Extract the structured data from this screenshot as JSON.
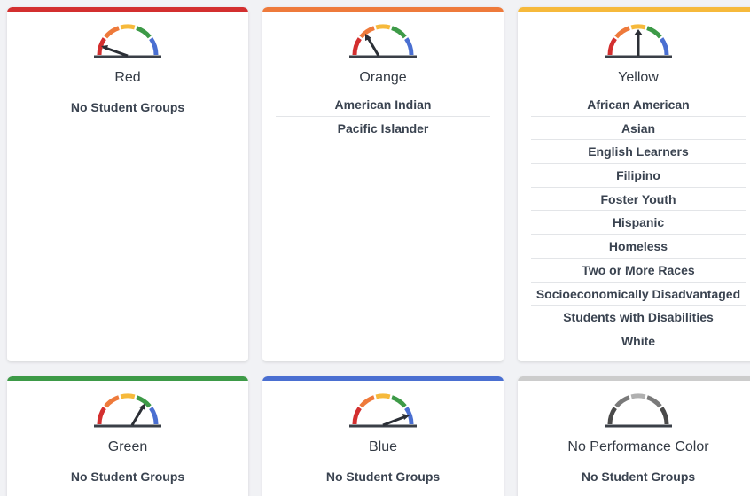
{
  "colors": {
    "red": "#d32f2f",
    "orange": "#ee7a3b",
    "yellow": "#f6b93b",
    "green": "#3d9a47",
    "blue": "#4a6fd1",
    "gray": "#cccccc"
  },
  "cards": [
    {
      "title": "Red",
      "gauge_icon": "gauge-red-icon",
      "empty_text": "No Student Groups",
      "groups": []
    },
    {
      "title": "Orange",
      "gauge_icon": "gauge-orange-icon",
      "groups": [
        "American Indian",
        "Pacific Islander"
      ]
    },
    {
      "title": "Yellow",
      "gauge_icon": "gauge-yellow-icon",
      "groups": [
        "African American",
        "Asian",
        "English Learners",
        "Filipino",
        "Foster Youth",
        "Hispanic",
        "Homeless",
        "Two or More Races",
        "Socioeconomically Disadvantaged",
        "Students with Disabilities",
        "White"
      ]
    },
    {
      "title": "Green",
      "gauge_icon": "gauge-green-icon",
      "empty_text": "No Student Groups",
      "groups": []
    },
    {
      "title": "Blue",
      "gauge_icon": "gauge-blue-icon",
      "empty_text": "No Student Groups",
      "groups": []
    },
    {
      "title": "No Performance Color",
      "gauge_icon": "gauge-none-icon",
      "empty_text": "No Student Groups",
      "groups": []
    }
  ]
}
